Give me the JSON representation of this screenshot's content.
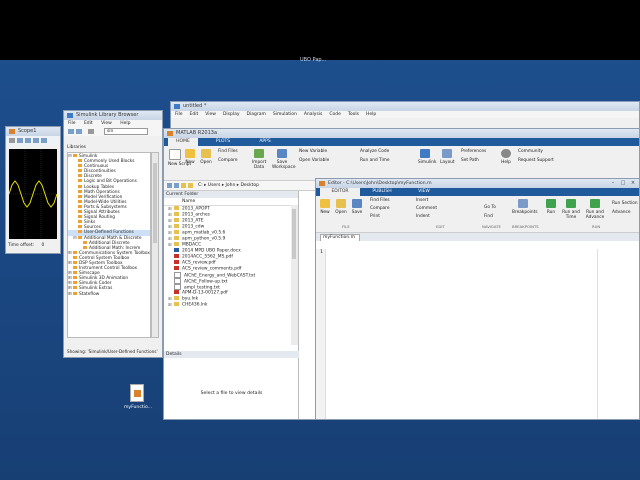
{
  "desktop": {
    "top_label": "UBO Pap..."
  },
  "scope": {
    "title": "Scope1",
    "status": "Time offset:",
    "offset_value": "0"
  },
  "library": {
    "title": "Simulink Library Browser",
    "menu": [
      "File",
      "Edit",
      "View",
      "Help"
    ],
    "search_value": "sin",
    "section_label": "Libraries",
    "items": [
      {
        "label": "Simulink",
        "exp": "⊟",
        "indent": 0
      },
      {
        "label": "Commonly Used Blocks",
        "exp": "",
        "indent": 1
      },
      {
        "label": "Continuous",
        "exp": "",
        "indent": 1
      },
      {
        "label": "Discontinuities",
        "exp": "",
        "indent": 1
      },
      {
        "label": "Discrete",
        "exp": "",
        "indent": 1
      },
      {
        "label": "Logic and Bit Operations",
        "exp": "",
        "indent": 1
      },
      {
        "label": "Lookup Tables",
        "exp": "",
        "indent": 1
      },
      {
        "label": "Math Operations",
        "exp": "",
        "indent": 1
      },
      {
        "label": "Model Verification",
        "exp": "",
        "indent": 1
      },
      {
        "label": "Model-Wide Utilities",
        "exp": "",
        "indent": 1
      },
      {
        "label": "Ports & Subsystems",
        "exp": "",
        "indent": 1
      },
      {
        "label": "Signal Attributes",
        "exp": "",
        "indent": 1
      },
      {
        "label": "Signal Routing",
        "exp": "",
        "indent": 1
      },
      {
        "label": "Sinks",
        "exp": "",
        "indent": 1
      },
      {
        "label": "Sources",
        "exp": "",
        "indent": 1
      },
      {
        "label": "User-Defined Functions",
        "exp": "",
        "indent": 1,
        "selected": true
      },
      {
        "label": "Additional Math & Discrete",
        "exp": "⊟",
        "indent": 1
      },
      {
        "label": "Additional Discrete",
        "exp": "",
        "indent": 2
      },
      {
        "label": "Additional Math: Increm",
        "exp": "",
        "indent": 2
      },
      {
        "label": "Communications System Toolbox",
        "exp": "⊞",
        "indent": 0
      },
      {
        "label": "Control System Toolbox",
        "exp": "",
        "indent": 0
      },
      {
        "label": "DSP System Toolbox",
        "exp": "⊞",
        "indent": 0
      },
      {
        "label": "Instrument Control Toolbox",
        "exp": "",
        "indent": 0
      },
      {
        "label": "Simscape",
        "exp": "⊞",
        "indent": 0
      },
      {
        "label": "Simulink 3D Animation",
        "exp": "⊞",
        "indent": 0
      },
      {
        "label": "Simulink Coder",
        "exp": "⊞",
        "indent": 0
      },
      {
        "label": "Simulink Extras",
        "exp": "⊞",
        "indent": 0
      },
      {
        "label": "Stateflow",
        "exp": "⊞",
        "indent": 0
      }
    ],
    "status": "Showing: 'Simulink/User-Defined Functions'"
  },
  "untitled": {
    "title": "untitled *",
    "menu": [
      "File",
      "Edit",
      "View",
      "Display",
      "Diagram",
      "Simulation",
      "Analysis",
      "Code",
      "Tools",
      "Help"
    ]
  },
  "matlab": {
    "title": "MATLAB R2013a",
    "tabs": [
      "HOME",
      "PLOTS",
      "APPS"
    ],
    "toolstrip": {
      "new_script": "New Script",
      "new": "New",
      "open": "Open",
      "find_files": "Find Files",
      "compare": "Compare",
      "import_data": "Import Data",
      "save_workspace": "Save Workspace",
      "new_variable": "New Variable",
      "open_variable": "Open Variable",
      "analyze_code": "Analyze Code",
      "run_and_time": "Run and Time",
      "simulink": "Simulink",
      "layout": "Layout",
      "preferences": "Preferences",
      "set_path": "Set Path",
      "help": "Help",
      "community": "Community",
      "request_support": "Request Support"
    },
    "path": [
      "C:",
      "Users",
      "John",
      "Desktop"
    ],
    "current_folder_label": "Current Folder",
    "name_header": "Name",
    "files": [
      {
        "name": "2013_APOPT",
        "type": "fold"
      },
      {
        "name": "2013_arches",
        "type": "fold"
      },
      {
        "name": "2013_ATE",
        "type": "fold"
      },
      {
        "name": "2013_cdw",
        "type": "fold"
      },
      {
        "name": "apm_matlab_v0.5.6",
        "type": "fold"
      },
      {
        "name": "apm_python_v0.5.9",
        "type": "fold"
      },
      {
        "name": "MBDACC",
        "type": "fold"
      },
      {
        "name": "2014 MPD UBO Paper.docx",
        "type": "doc"
      },
      {
        "name": "2014ACC_5562_MS.pdf",
        "type": "pdf"
      },
      {
        "name": "ACS_review.pdf",
        "type": "pdf"
      },
      {
        "name": "ACS_review_comments.pdf",
        "type": "pdf"
      },
      {
        "name": "AIChE_Energy_and_WebCAST.txt",
        "type": "txt"
      },
      {
        "name": "AIChE_Follow-up.txt",
        "type": "txt"
      },
      {
        "name": "ampl_testing.txt",
        "type": "txt"
      },
      {
        "name": "APM-D-13-00127.pdf",
        "type": "pdf"
      },
      {
        "name": "byu.lnk",
        "type": "fold"
      },
      {
        "name": "CHE436.lnk",
        "type": "fold"
      }
    ],
    "details_label": "Details",
    "details_hint": "Select a file to view details"
  },
  "editor": {
    "title": "Editor - C:\\Users\\John\\Desktop\\myFunction.m",
    "tabs": [
      "EDITOR",
      "PUBLISH",
      "VIEW"
    ],
    "toolstrip": {
      "new": "New",
      "open": "Open",
      "save": "Save",
      "find_files": "Find Files",
      "compare": "Compare",
      "print": "Print",
      "insert": "Insert",
      "comment": "Comment",
      "indent": "Indent",
      "go_to": "Go To",
      "find": "Find",
      "breakpoints": "Breakpoints",
      "run": "Run",
      "run_and_time": "Run and Time",
      "run_and_advance": "Run and Advance",
      "run_section": "Run Section",
      "advance": "Advance"
    },
    "groups": [
      "FILE",
      "EDIT",
      "NAVIGATE",
      "BREAKPOINTS",
      "RUN"
    ],
    "doc_tab": "myFunction.m",
    "line_number": "1"
  },
  "desktop_icon": {
    "label": "myFunctio..."
  }
}
